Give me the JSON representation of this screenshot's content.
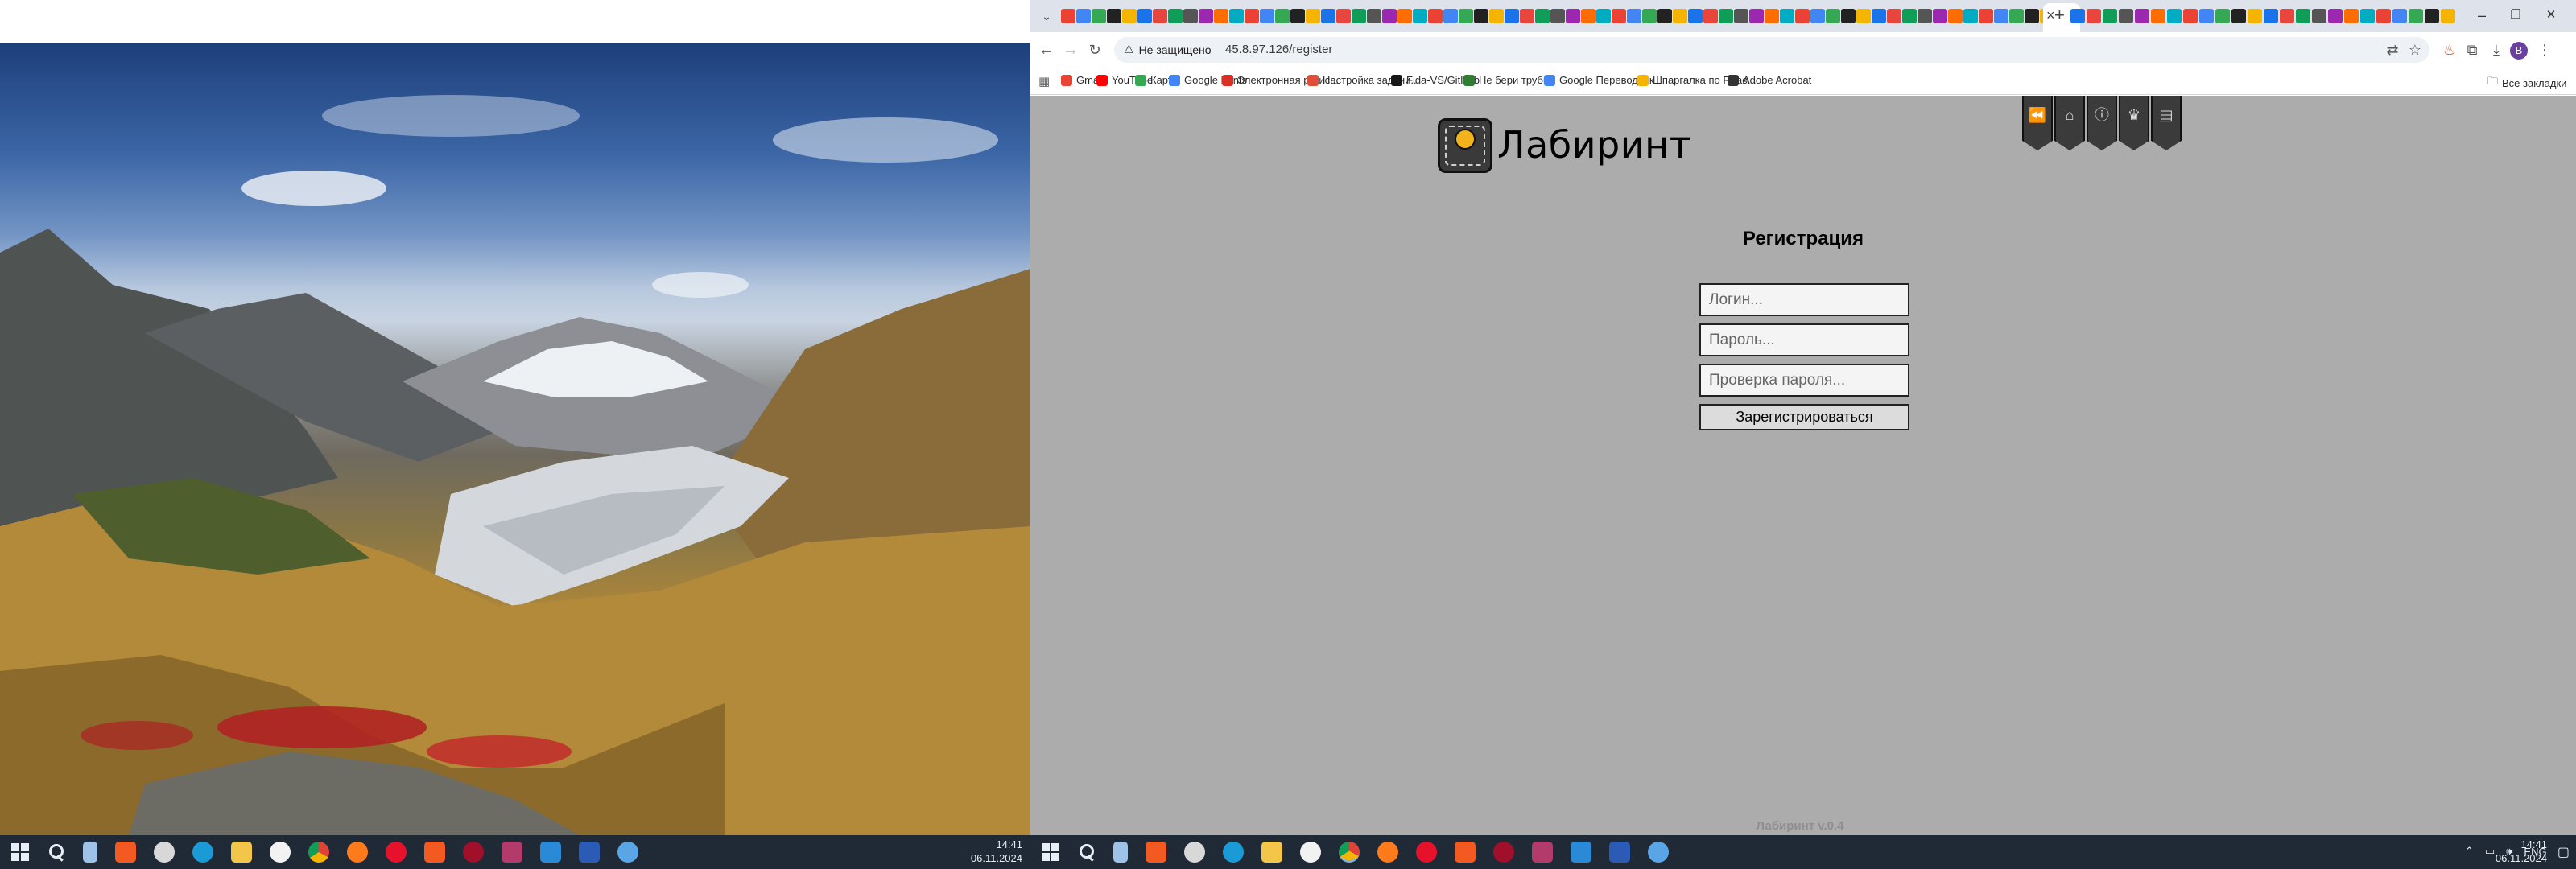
{
  "left_monitor": {
    "taskbar": {
      "pinned": [
        "brave",
        "steam",
        "edge",
        "file-explorer",
        "yandex-browser",
        "chrome",
        "firefox",
        "opera",
        "opera-alt",
        "opera-gx",
        "winrar",
        "vscode",
        "word",
        "lightshot"
      ],
      "clock_time": "14:41",
      "clock_date": "06.11.2024"
    }
  },
  "browser": {
    "tab": {
      "close_label": "×",
      "new_tab_label": "+"
    },
    "window_controls": {
      "minimize": "–",
      "restore": "❐",
      "close": "✕"
    },
    "address": {
      "security_label": "Не защищено",
      "url": "45.8.97.126/register"
    },
    "bookmarks": [
      {
        "label": "Gmail",
        "color": "#ea4335"
      },
      {
        "label": "YouTube",
        "color": "#ff0000"
      },
      {
        "label": "Карты",
        "color": "#34a853"
      },
      {
        "label": "Google Fonts",
        "color": "#4285f4"
      },
      {
        "label": "Электронная регис...",
        "color": "#d93025"
      },
      {
        "label": "Настройка задачи...",
        "color": "#e04e39"
      },
      {
        "label": "Fida-VS/GitHub",
        "color": "#181717"
      },
      {
        "label": "Не бери трубку",
        "color": "#2e7d32"
      },
      {
        "label": "Google Переводчик",
        "color": "#4285f4"
      },
      {
        "label": "Шпаргалка по Reac...",
        "color": "#f4b400"
      },
      {
        "label": "Adobe Acrobat",
        "color": "#333333"
      }
    ],
    "bookmarks_folder": "Все закладки",
    "profile_initial": "В"
  },
  "page": {
    "site_title": "Лабиринт",
    "nav_icons": [
      "rewind-icon",
      "home-icon",
      "info-icon",
      "trophy-icon",
      "document-icon"
    ],
    "register": {
      "title": "Регистрация",
      "login_placeholder": "Логин...",
      "password_placeholder": "Пароль...",
      "password_confirm_placeholder": "Проверка пароля...",
      "submit_label": "Зарегистрироваться"
    },
    "version": "Лабиринт v.0.4"
  },
  "right_monitor": {
    "taskbar": {
      "pinned": [
        "brave",
        "steam",
        "edge",
        "file-explorer",
        "yandex-browser",
        "chrome",
        "firefox",
        "opera",
        "opera-alt",
        "opera-gx",
        "winrar",
        "vscode",
        "word",
        "lightshot"
      ],
      "tray_lang": "ENG",
      "clock_time": "14:41",
      "clock_date": "06.11.2024"
    }
  },
  "colors": {
    "page_background": "#acacac",
    "taskbar": "#1f2a36",
    "tabstrip": "#dee3eb"
  }
}
